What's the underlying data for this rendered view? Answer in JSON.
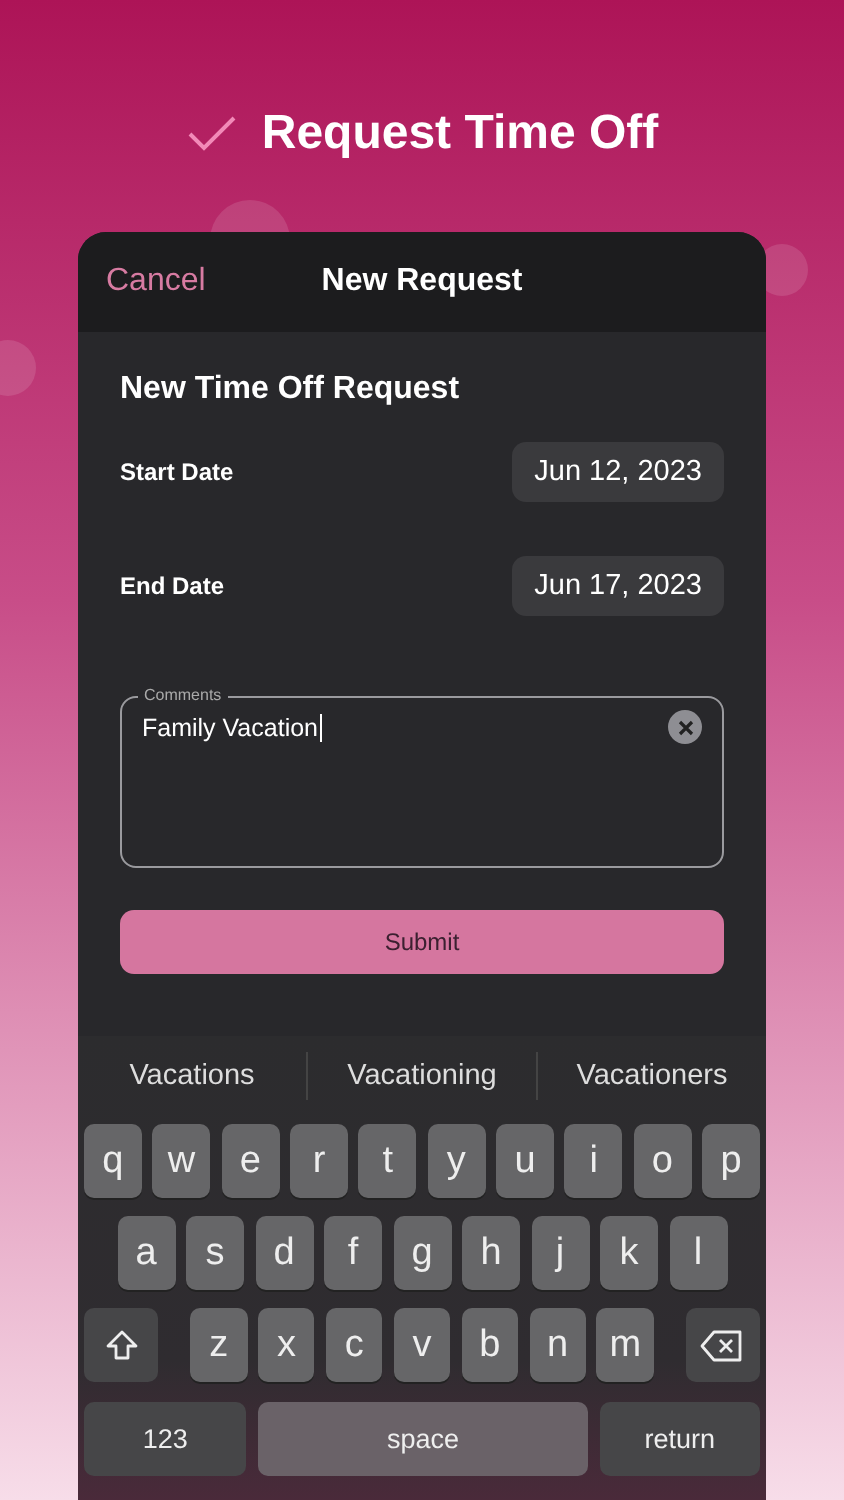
{
  "headline": {
    "title": "Request Time Off"
  },
  "nav": {
    "cancel": "Cancel",
    "title": "New Request"
  },
  "form": {
    "heading": "New Time Off Request",
    "dates": [
      {
        "label": "Start Date",
        "value": "Jun 12, 2023"
      },
      {
        "label": "End Date",
        "value": "Jun 17, 2023"
      }
    ],
    "comments": {
      "label": "Comments",
      "value": "Family Vacation"
    },
    "submit": "Submit"
  },
  "keyboard": {
    "suggestions": [
      "Vacations",
      "Vacationing",
      "Vacationers"
    ],
    "rows": [
      [
        "q",
        "w",
        "e",
        "r",
        "t",
        "y",
        "u",
        "i",
        "o",
        "p"
      ],
      [
        "a",
        "s",
        "d",
        "f",
        "g",
        "h",
        "j",
        "k",
        "l"
      ],
      [
        "z",
        "x",
        "c",
        "v",
        "b",
        "n",
        "m"
      ]
    ],
    "numbers": "123",
    "space": "space",
    "return": "return"
  }
}
